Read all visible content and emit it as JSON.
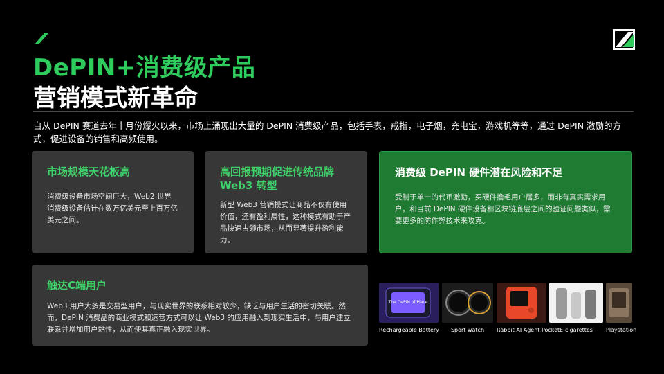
{
  "header": {
    "title_line1": "DePIN+消费级产品",
    "title_line2": "营销模式新革命"
  },
  "intro": "自从 DePIN 赛道去年十月份爆火以来，市场上涌现出大量的 DePIN 消费级产品，包括手表，戒指，电子烟，充电宝，游戏机等等，通过 DePIN 激励的方式，促进设备的销售和高频使用。",
  "cards": [
    {
      "title": "市场规模天花板高",
      "body": "消费级设备市场空间巨大，Web2 世界消费级设备估计在数万亿美元至上百万亿美元之间。"
    },
    {
      "title": "高回报预期促进传统品牌 Web3 转型",
      "body": "新型 Web3 营销模式让商品不仅有使用价值，还有盈利属性，这种模式有助于产品快速占领市场，从而显著提升盈利能力。"
    },
    {
      "title": "消费级 DePIN 硬件潜在风险和不足",
      "body": "受制于单一的代币激励，买硬件撸毛用户居多，而非有真实需求用户，和目前 DePIN 硬件设备和区块链底层之间的验证问题类似，需要更多的防作弊技术来攻克。"
    },
    {
      "title": "触达C端用户",
      "body": "Web3 用户大多是交易型用户，与现实世界的联系相对较少，缺乏与用户生活的密切关联。然而，DePIN 消费品的商业模式和运营方式可以让 Web3 的应用融入到现实生活中，与用户建立联系并增加用户黏性，从而使其真正融入现实世界。"
    }
  ],
  "products": [
    {
      "label": "Rechargeable Battery",
      "screen_text": "The DePIN of Place"
    },
    {
      "label": "Sport watch"
    },
    {
      "label": "Rabbit AI Agent Pocket"
    },
    {
      "label": "E-cigarettes"
    },
    {
      "label": "Playstation"
    }
  ],
  "colors": {
    "accent": "#2ecc5c",
    "card": "#373737",
    "card_green": "#1f7a32"
  }
}
